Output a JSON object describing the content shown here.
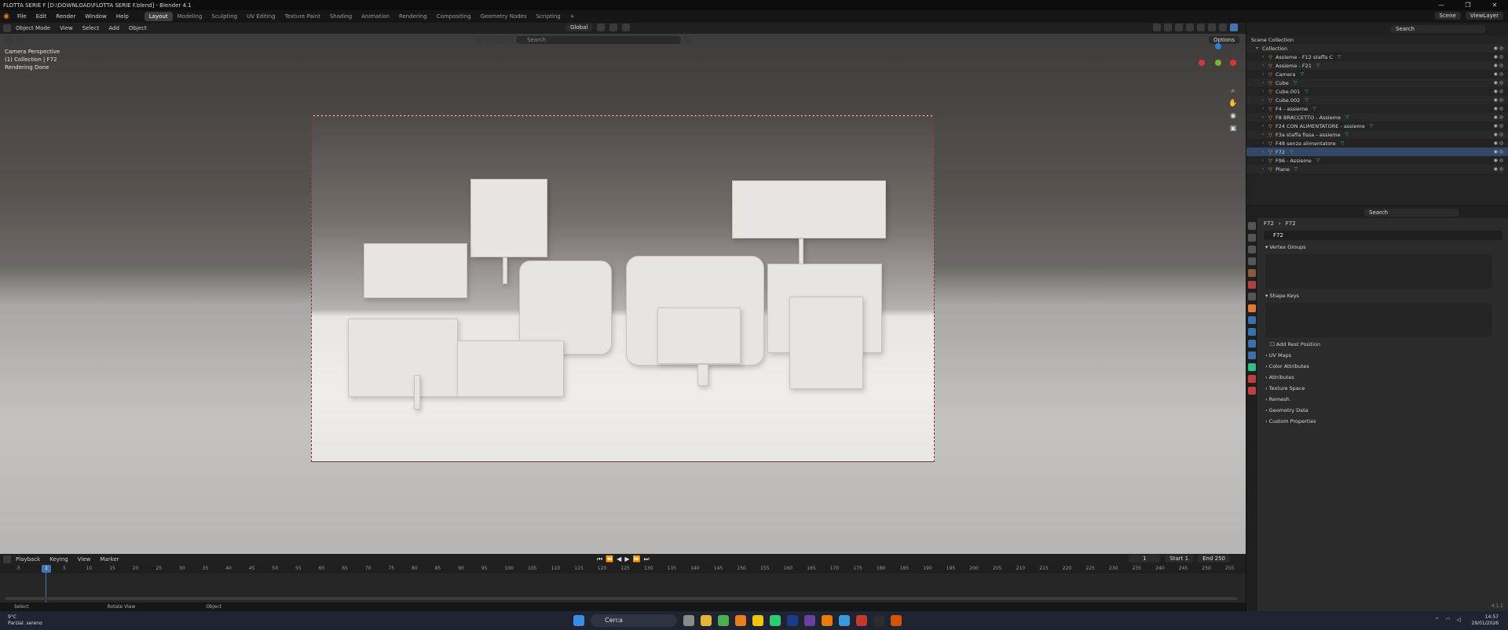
{
  "window": {
    "title": "FLOTTA SERIE F [D:\\DOWNLOAD\\FLOTTA SERIE F.blend] - Blender 4.1",
    "controls": [
      "—",
      "❐",
      "✕"
    ]
  },
  "menu": {
    "items": [
      "File",
      "Edit",
      "Render",
      "Window",
      "Help"
    ],
    "tabs": [
      "Layout",
      "Modeling",
      "Sculpting",
      "UV Editing",
      "Texture Paint",
      "Shading",
      "Animation",
      "Rendering",
      "Compositing",
      "Geometry Nodes",
      "Scripting",
      "+"
    ],
    "active_tab": "Layout",
    "scene": "Scene",
    "view_layer": "ViewLayer"
  },
  "viewport_header": {
    "mode": "Object Mode",
    "items": [
      "View",
      "Select",
      "Add",
      "Object"
    ],
    "transform": "Global",
    "options": "Options"
  },
  "viewport": {
    "search_placeholder": "Search",
    "overlay_lines": [
      "Camera Perspective",
      "(1) Collection | F72",
      "Rendering Done"
    ]
  },
  "timeline": {
    "items": [
      "Playback",
      "Keying",
      "View",
      "Marker"
    ],
    "current_frame": "1",
    "start_label": "Start",
    "start": "1",
    "end_label": "End",
    "end": "250",
    "ticks": [
      "-5",
      "1",
      "5",
      "10",
      "15",
      "20",
      "25",
      "30",
      "35",
      "40",
      "45",
      "50",
      "55",
      "60",
      "65",
      "70",
      "75",
      "80",
      "85",
      "90",
      "95",
      "100",
      "105",
      "110",
      "115",
      "120",
      "125",
      "130",
      "135",
      "140",
      "145",
      "150",
      "155",
      "160",
      "165",
      "170",
      "175",
      "180",
      "185",
      "190",
      "195",
      "200",
      "205",
      "210",
      "215",
      "220",
      "225",
      "230",
      "235",
      "240",
      "245",
      "250",
      "255"
    ]
  },
  "statusbar": {
    "items": [
      "Select",
      "Rotate View",
      "Object"
    ],
    "version": "4.1.1"
  },
  "outliner": {
    "search_placeholder": "Search",
    "root": "Scene Collection",
    "collection": "Collection",
    "rows": [
      "Assieme - F12 staffa C",
      "Assieme - F21",
      "Camera",
      "Cube",
      "Cube.001",
      "Cube.002",
      "F4 - assieme",
      "F8 BRACCETTO - Assieme",
      "F24 CON ALIMENTATORE - assieme",
      "F3a staffa fissa - assieme",
      "F48 senza alimentatore",
      "F72",
      "F96 - Assieme",
      "Plane"
    ]
  },
  "properties": {
    "search_placeholder": "Search",
    "breadcrumb": [
      "F72",
      "F72"
    ],
    "name": "F72",
    "panels": {
      "vertex_groups": "Vertex Groups",
      "shape_keys": "Shape Keys",
      "add_rest_position": "Add Rest Position",
      "uv_maps": "UV Maps",
      "color_attributes": "Color Attributes",
      "attributes": "Attributes",
      "texture_space": "Texture Space",
      "remesh": "Remesh",
      "geometry_data": "Geometry Data",
      "custom_properties": "Custom Properties"
    }
  },
  "taskbar": {
    "temp": "9°C",
    "weather": "Parzial. sereno",
    "search": "Cerca",
    "time": "14:57",
    "date": "29/01/2026"
  }
}
